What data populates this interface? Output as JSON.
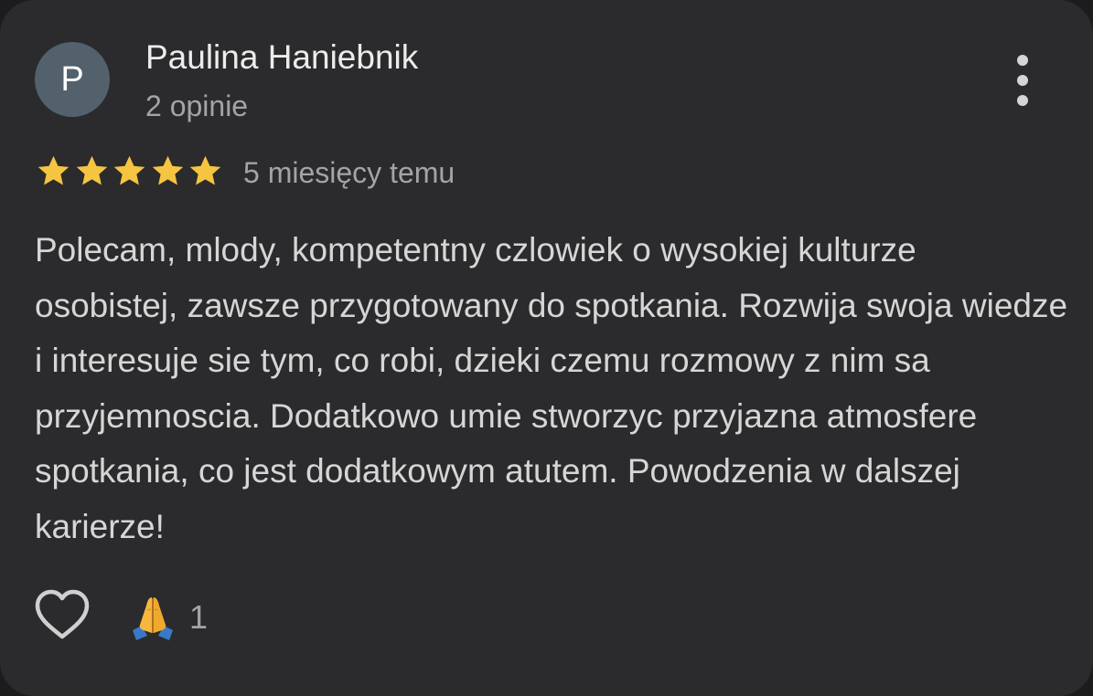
{
  "review": {
    "author": {
      "initial": "P",
      "name": "Paulina Haniebnik",
      "review_count": "2 opinie",
      "avatar_color": "#52616b"
    },
    "rating": 5,
    "rating_max": 5,
    "star_color": "#f5c542",
    "date": "5 miesięcy temu",
    "text": "Polecam, mlody, kompetentny czlowiek o wysokiej kulturze osobistej, zawsze przygotowany do spotkania. Rozwija swoja wiedze i interesuje sie tym, co robi, dzieki czemu rozmowy z nim sa przyjemnoscia. Dodatkowo umie stworzyc przyjazna atmosfere spotkania, co jest dodatkowym atutem. Powodzenia w dalszej karierze!",
    "actions": {
      "like_icon": "heart-outline-icon",
      "more_icon": "more-vertical-icon"
    },
    "reaction": {
      "icon": "folded-hands-emoji",
      "count": "1"
    }
  }
}
